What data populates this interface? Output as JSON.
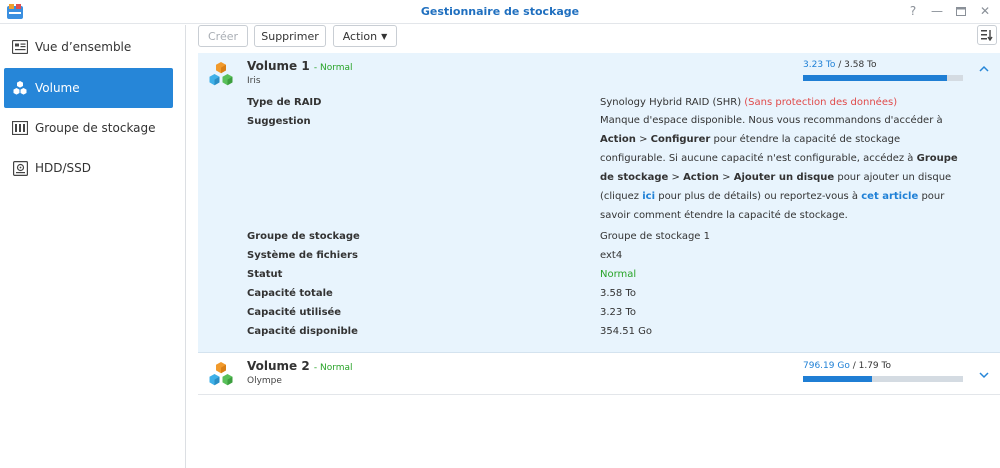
{
  "window": {
    "title": "Gestionnaire de stockage"
  },
  "sidebar": {
    "items": [
      {
        "label": "Vue d’ensemble",
        "icon": "overview-icon"
      },
      {
        "label": "Volume",
        "icon": "volume-cubes-icon",
        "active": true
      },
      {
        "label": "Groupe de stockage",
        "icon": "storage-pool-icon"
      },
      {
        "label": "HDD/SSD",
        "icon": "hdd-icon"
      }
    ]
  },
  "toolbar": {
    "create_label": "Créer",
    "delete_label": "Supprimer",
    "action_label": "Action"
  },
  "volumes": [
    {
      "name": "Volume 1",
      "status": "- Normal",
      "description": "Iris",
      "used": "3.23 To",
      "total": "/ 3.58 To",
      "used_fraction": 0.902,
      "expanded": true,
      "details": {
        "raid_type_label": "Type de RAID",
        "raid_type_value": "Synology Hybrid RAID (SHR)",
        "raid_warning": "(Sans protection des données)",
        "suggestion_label": "Suggestion",
        "suggestion": {
          "p1": "Manque d'espace disponible. Nous vous recommandons d'accéder à",
          "b1": "Action",
          "p2": ">",
          "b2": "Configurer",
          "p3": "pour étendre la capacité de stockage configurable. Si aucune capacité n'est configurable, accédez à",
          "b3": "Groupe de stockage",
          "p4": ">",
          "b4": "Action",
          "p5": ">",
          "b5": "Ajouter un disque",
          "p6": "pour ajouter un disque (cliquez",
          "link1": "ici",
          "p7": "pour plus de détails) ou reportez-vous à",
          "link2": "cet article",
          "p8": "pour savoir comment étendre la capacité de stockage."
        },
        "rows": [
          {
            "label": "Groupe de stockage",
            "value": "Groupe de stockage 1"
          },
          {
            "label": "Système de fichiers",
            "value": "ext4"
          },
          {
            "label": "Statut",
            "value": "Normal"
          },
          {
            "label": "Capacité totale",
            "value": "3.58 To"
          },
          {
            "label": "Capacité utilisée",
            "value": "3.23 To"
          },
          {
            "label": "Capacité disponible",
            "value": "354.51 Go"
          }
        ]
      }
    },
    {
      "name": "Volume 2",
      "status": "- Normal",
      "description": "Olympe",
      "used": "796.19 Go",
      "total": "/ 1.79 To",
      "used_fraction": 0.434,
      "expanded": false
    }
  ],
  "colors": {
    "accent": "#2686d8",
    "status_ok": "#28a428",
    "warning": "#e04a4a",
    "expanded_bg": "#e8f4fd"
  }
}
